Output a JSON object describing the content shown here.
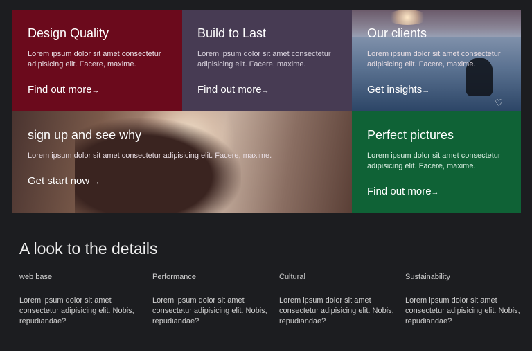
{
  "tiles": [
    {
      "title": "Design Quality",
      "text": "Lorem ipsum dolor sit amet consectetur adipisicing elit. Facere, maxime.",
      "link": "Find out more",
      "arrow": "→",
      "color": "#6b0a1c"
    },
    {
      "title": "Build to Last",
      "text": "Lorem ipsum dolor sit amet consectetur adipisicing elit. Facere, maxime.",
      "link": "Find out more",
      "arrow": "→",
      "color": "#473b53"
    },
    {
      "title": "Our clients",
      "text": "Lorem ipsum dolor sit amet consectetur adipisicing elit. Facere, maxime.",
      "link": "Get insights",
      "arrow": "→",
      "icon": "heart-icon"
    },
    {
      "title": "sign up and see why",
      "text": "Lorem ipsum dolor sit amet consectetur adipisicing elit. Facere, maxime.",
      "link": "Get start now",
      "arrow": "→"
    },
    {
      "title": "Perfect pictures",
      "text": "Lorem ipsum dolor sit amet consectetur adipisicing elit. Facere, maxime.",
      "link": "Find out more",
      "arrow": "→",
      "color": "#0f6236"
    }
  ],
  "details": {
    "heading": "A look to the details",
    "columns": [
      {
        "label": "web base",
        "text": "Lorem ipsum dolor sit amet consectetur adipisicing elit. Nobis, repudiandae?"
      },
      {
        "label": "Performance",
        "text": "Lorem ipsum dolor sit amet consectetur adipisicing elit. Nobis, repudiandae?"
      },
      {
        "label": "Cultural",
        "text": "Lorem ipsum dolor sit amet consectetur adipisicing elit. Nobis, repudiandae?"
      },
      {
        "label": "Sustainability",
        "text": "Lorem ipsum dolor sit amet consectetur adipisicing elit. Nobis, repudiandae?"
      }
    ]
  },
  "icons": {
    "heart": "♡"
  }
}
